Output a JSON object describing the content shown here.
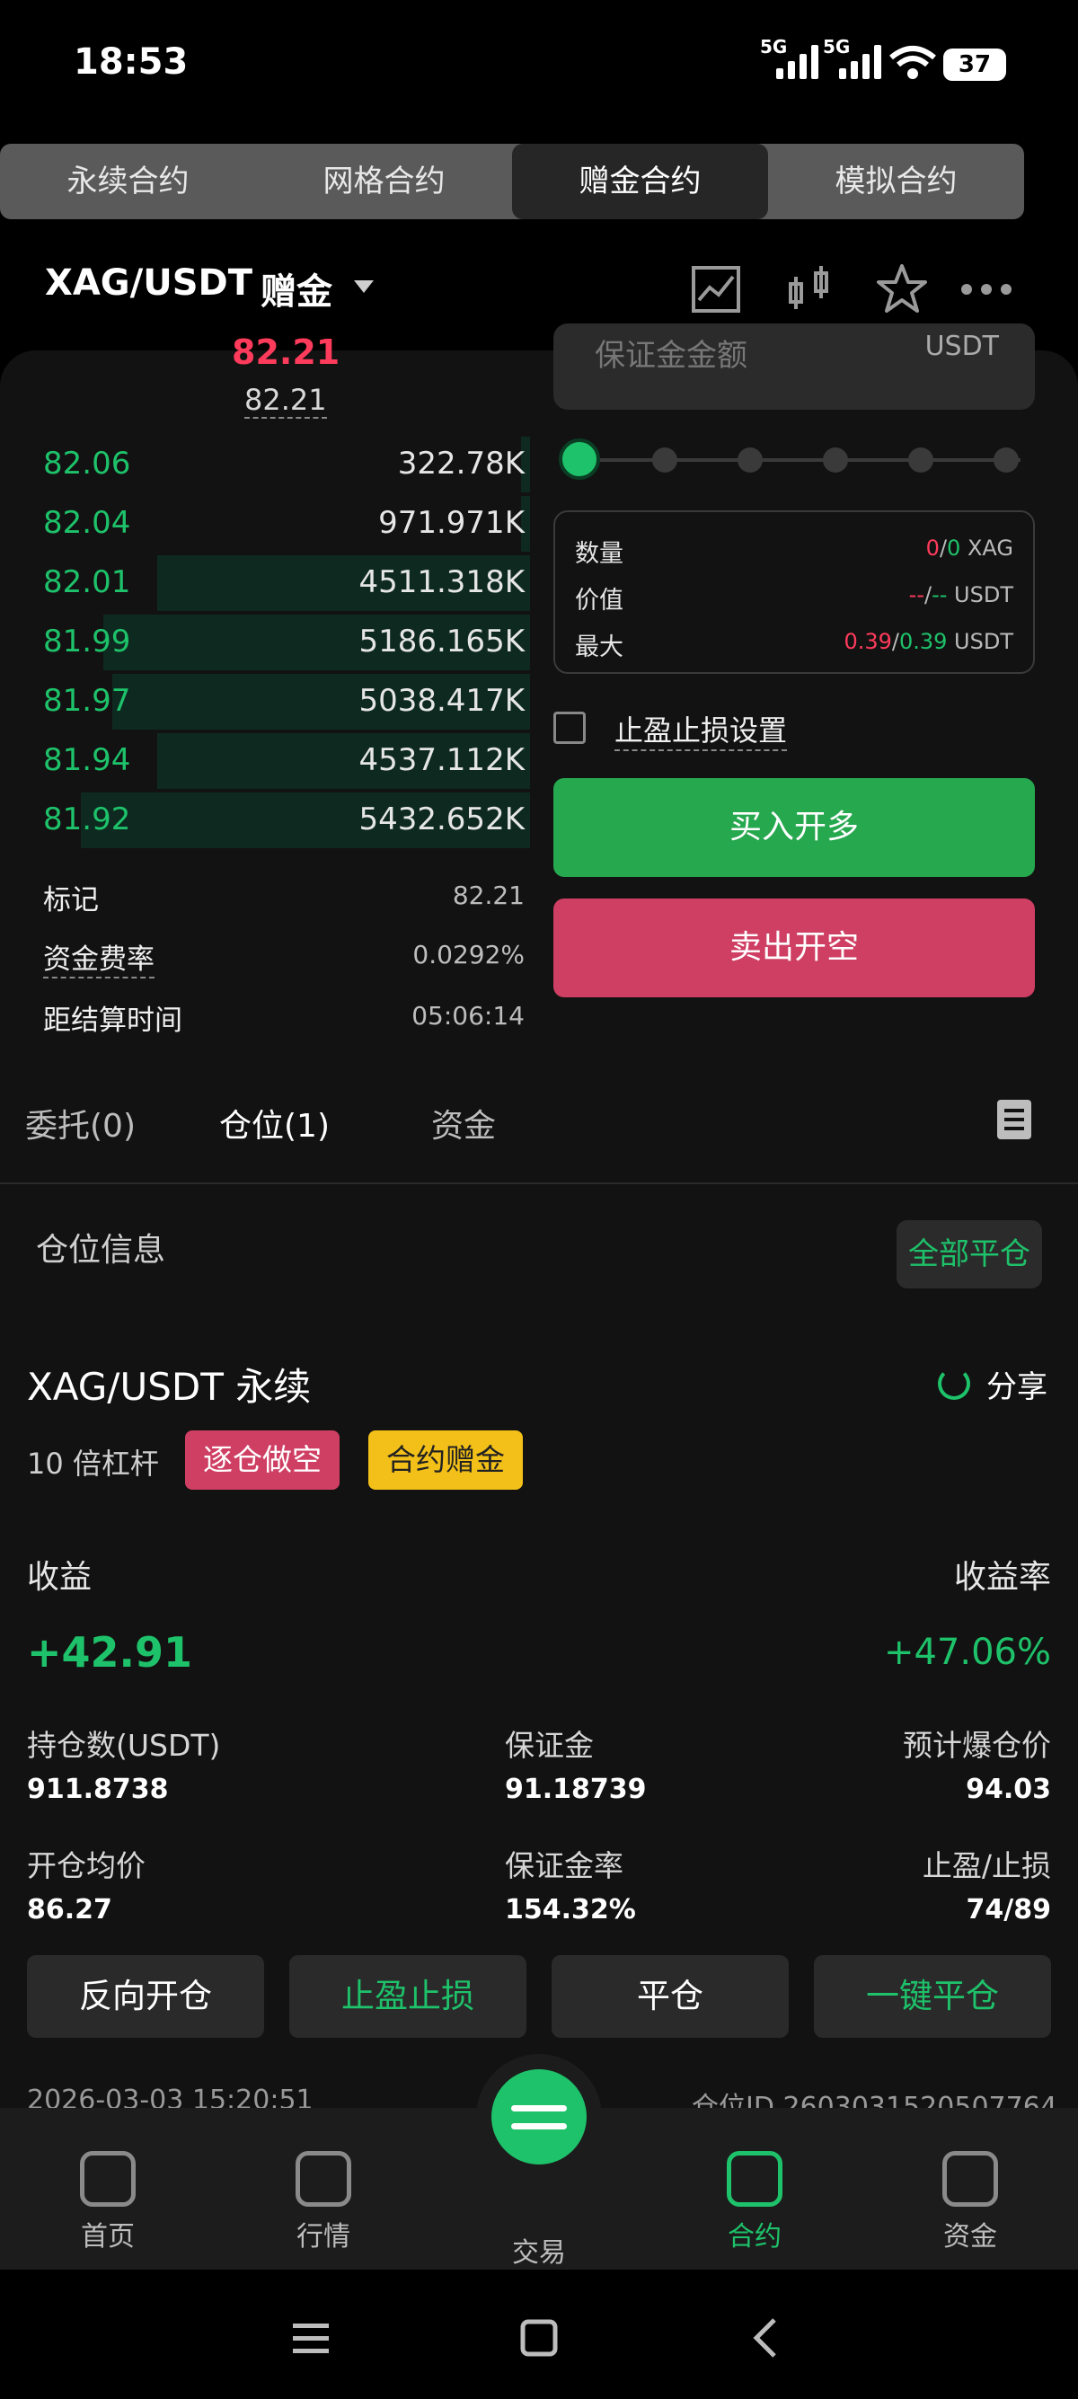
{
  "status": {
    "time": "18:53",
    "signal_label": "5G",
    "battery": "37"
  },
  "top_tabs": [
    "永续合约",
    "网格合约",
    "赠金合约",
    "模拟合约"
  ],
  "top_tab_active": 2,
  "symbol": {
    "pair": "XAG/USDT",
    "mode": "赠金"
  },
  "order_book": {
    "last_price": "82.21",
    "mark_price": "82.21",
    "bids": [
      {
        "price": "82.06",
        "qty": "322.78K",
        "depth": 0.02
      },
      {
        "price": "82.04",
        "qty": "971.971K",
        "depth": 0.02
      },
      {
        "price": "82.01",
        "qty": "4511.318K",
        "depth": 0.83
      },
      {
        "price": "81.99",
        "qty": "5186.165K",
        "depth": 0.95
      },
      {
        "price": "81.97",
        "qty": "5038.417K",
        "depth": 0.93
      },
      {
        "price": "81.94",
        "qty": "4537.112K",
        "depth": 0.83
      },
      {
        "price": "81.92",
        "qty": "5432.652K",
        "depth": 1.0
      }
    ],
    "mark_label": "标记",
    "mark_value": "82.21",
    "funding_label": "资金费率",
    "funding_value": "0.0292%",
    "settle_label": "距结算时间",
    "settle_value": "05:06:14"
  },
  "order_form": {
    "margin_placeholder": "保证金金额",
    "margin_unit": "USDT",
    "slider_percent": 0,
    "qty_label": "数量",
    "qty_a": "0",
    "qty_b": "0",
    "qty_unit": "XAG",
    "value_label": "价值",
    "value_a": "--",
    "value_b": "--",
    "value_unit": "USDT",
    "max_label": "最大",
    "max_a": "0.39",
    "max_b": "0.39",
    "max_unit": "USDT",
    "tpsl_label": "止盈止损设置",
    "buy_label": "买入开多",
    "sell_label": "卖出开空"
  },
  "sub_tabs": {
    "orders": "委托(0)",
    "positions": "仓位(1)",
    "funds": "资金"
  },
  "position": {
    "section_label": "仓位信息",
    "close_all": "全部平仓",
    "title": "XAG/USDT 永续",
    "share": "分享",
    "leverage": "10 倍杠杆",
    "badge_side": "逐仓做空",
    "badge_bonus": "合约赠金",
    "pnl_label": "收益",
    "pnl_rate_label": "收益率",
    "pnl": "+42.91",
    "pnl_rate": "+47.06%",
    "size_label": "持仓数(USDT)",
    "size": "911.8738",
    "margin_label": "保证金",
    "margin": "91.18739",
    "liq_label": "预计爆仓价",
    "liq": "94.03",
    "entry_label": "开仓均价",
    "entry": "86.27",
    "margin_rate_label": "保证金率",
    "margin_rate": "154.32%",
    "tpsl_label": "止盈/止损",
    "tpsl": "74/89",
    "btn_reverse": "反向开仓",
    "btn_tpsl": "止盈止损",
    "btn_close": "平仓",
    "btn_close_all": "一键平仓",
    "open_time": "2026-03-03 15:20:51",
    "position_id": "仓位ID 2603031520507764"
  },
  "bottom_nav": [
    "首页",
    "行情",
    "交易",
    "合约",
    "资金"
  ],
  "bottom_nav_active": 3,
  "colors": {
    "green": "#1ec26a",
    "red": "#cf3f63",
    "yellow": "#f2c018"
  }
}
